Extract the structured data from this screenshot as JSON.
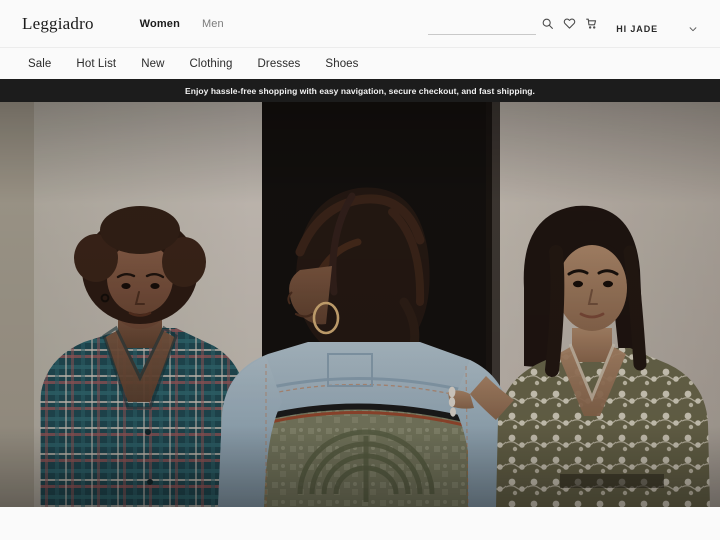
{
  "header": {
    "logo": "Leggiadro",
    "primary_nav": [
      {
        "label": "Women",
        "active": true
      },
      {
        "label": "Men",
        "active": false
      }
    ],
    "search": {
      "value": "",
      "placeholder": ""
    },
    "icons": [
      "search-icon",
      "wishlist-heart-icon",
      "cart-icon"
    ],
    "user_greeting": "HI JADE",
    "dropdown_icon": "chevron-down-icon"
  },
  "subnav": {
    "items": [
      {
        "label": "Sale"
      },
      {
        "label": "Hot List"
      },
      {
        "label": "New"
      },
      {
        "label": "Clothing"
      },
      {
        "label": "Dresses"
      },
      {
        "label": "Shoes"
      }
    ]
  },
  "announcement": {
    "text": "Enjoy hassle-free shopping with easy navigation, secure checkout, and fast shipping.",
    "background": "#1c1c1c",
    "color": "#f2f2f2"
  },
  "hero": {
    "alt": "Three women modeling plaid flannel, denim jacket and floral print shirt against a neutral studio wall",
    "colors": {
      "wall_left": "#cdc6bd",
      "wall_right": "#c9c1b7",
      "backdrop_dark": "#120f0d",
      "denim": "#a8bdcb",
      "plaid_teal": "#24535c",
      "floral_olive": "#6f6a4e",
      "sage": "#8e9173"
    }
  },
  "theme": {
    "page_background": "#fafafa",
    "text_primary": "#1b1b1b",
    "text_muted": "#7b7b7b",
    "divider": "#ececec"
  }
}
